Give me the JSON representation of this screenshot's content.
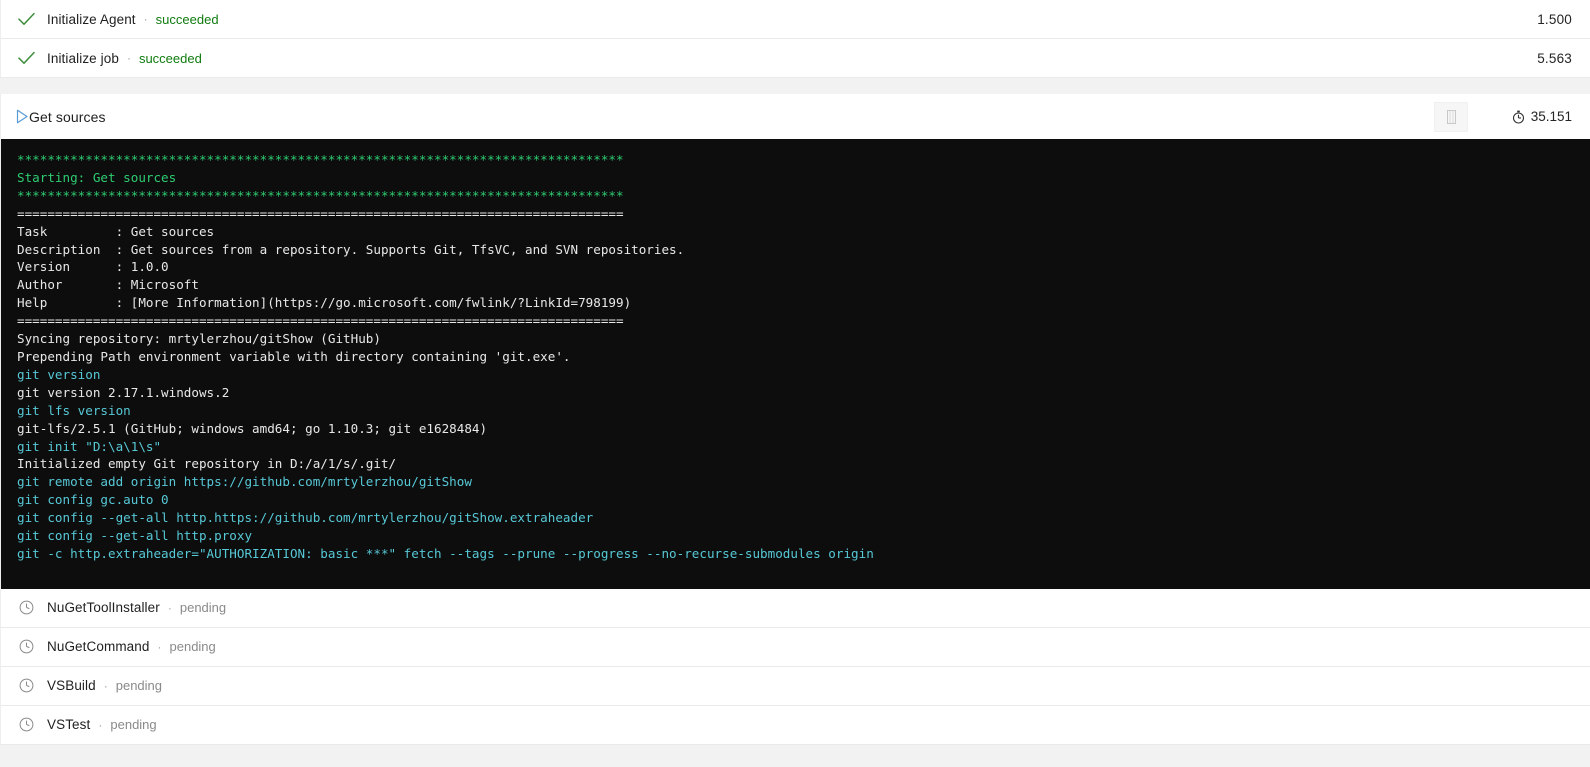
{
  "steps_before": [
    {
      "icon": "check-icon",
      "name": "Initialize Agent",
      "separator": "·",
      "status": "succeeded",
      "status_kind": "succeeded",
      "duration": "1.500"
    },
    {
      "icon": "check-icon",
      "name": "Initialize job",
      "separator": "·",
      "status": "succeeded",
      "status_kind": "succeeded",
      "duration": "5.563"
    }
  ],
  "expanded_step": {
    "icon": "play-triangle-icon",
    "title": "Get sources",
    "download_button_icon": "download-log-icon",
    "timer_icon": "stopwatch-icon",
    "duration": "35.151"
  },
  "console": {
    "lines": [
      {
        "text": "********************************************************************************",
        "color": "green"
      },
      {
        "text": "Starting: Get sources",
        "color": "green"
      },
      {
        "text": "********************************************************************************",
        "color": "green"
      },
      {
        "text": "================================================================================",
        "color": "white"
      },
      {
        "text": "Task         : Get sources",
        "color": "white"
      },
      {
        "text": "Description  : Get sources from a repository. Supports Git, TfsVC, and SVN repositories.",
        "color": "white"
      },
      {
        "text": "Version      : 1.0.0",
        "color": "white"
      },
      {
        "text": "Author       : Microsoft",
        "color": "white"
      },
      {
        "text": "Help         : [More Information](https://go.microsoft.com/fwlink/?LinkId=798199)",
        "color": "white"
      },
      {
        "text": "================================================================================",
        "color": "white"
      },
      {
        "text": "Syncing repository: mrtylerzhou/gitShow (GitHub)",
        "color": "white"
      },
      {
        "text": "Prepending Path environment variable with directory containing 'git.exe'.",
        "color": "white"
      },
      {
        "text": "git version",
        "color": "cyan"
      },
      {
        "text": "git version 2.17.1.windows.2",
        "color": "white"
      },
      {
        "text": "git lfs version",
        "color": "cyan"
      },
      {
        "text": "git-lfs/2.5.1 (GitHub; windows amd64; go 1.10.3; git e1628484)",
        "color": "white"
      },
      {
        "text": "git init \"D:\\a\\1\\s\"",
        "color": "cyan"
      },
      {
        "text": "Initialized empty Git repository in D:/a/1/s/.git/",
        "color": "white"
      },
      {
        "text": "git remote add origin https://github.com/mrtylerzhou/gitShow",
        "color": "cyan"
      },
      {
        "text": "git config gc.auto 0",
        "color": "cyan"
      },
      {
        "text": "git config --get-all http.https://github.com/mrtylerzhou/gitShow.extraheader",
        "color": "cyan"
      },
      {
        "text": "git config --get-all http.proxy",
        "color": "cyan"
      },
      {
        "text": "git -c http.extraheader=\"AUTHORIZATION: basic ***\" fetch --tags --prune --progress --no-recurse-submodules origin",
        "color": "cyan"
      }
    ]
  },
  "steps_after": [
    {
      "icon": "clock-icon",
      "name": "NuGetToolInstaller",
      "separator": "·",
      "status": "pending",
      "status_kind": "pending",
      "duration": ""
    },
    {
      "icon": "clock-icon",
      "name": "NuGetCommand",
      "separator": "·",
      "status": "pending",
      "status_kind": "pending",
      "duration": ""
    },
    {
      "icon": "clock-icon",
      "name": "VSBuild",
      "separator": "·",
      "status": "pending",
      "status_kind": "pending",
      "duration": ""
    },
    {
      "icon": "clock-icon",
      "name": "VSTest",
      "separator": "·",
      "status": "pending",
      "status_kind": "pending",
      "duration": ""
    }
  ],
  "colors": {
    "success_green": "#107c10",
    "pending_gray": "#8a8a8a",
    "accent_blue": "#5a9bd5",
    "console_bg": "#0d0d0d",
    "console_green": "#2ecc71",
    "console_cyan": "#57c8d6",
    "console_text": "#e8e8e8"
  }
}
